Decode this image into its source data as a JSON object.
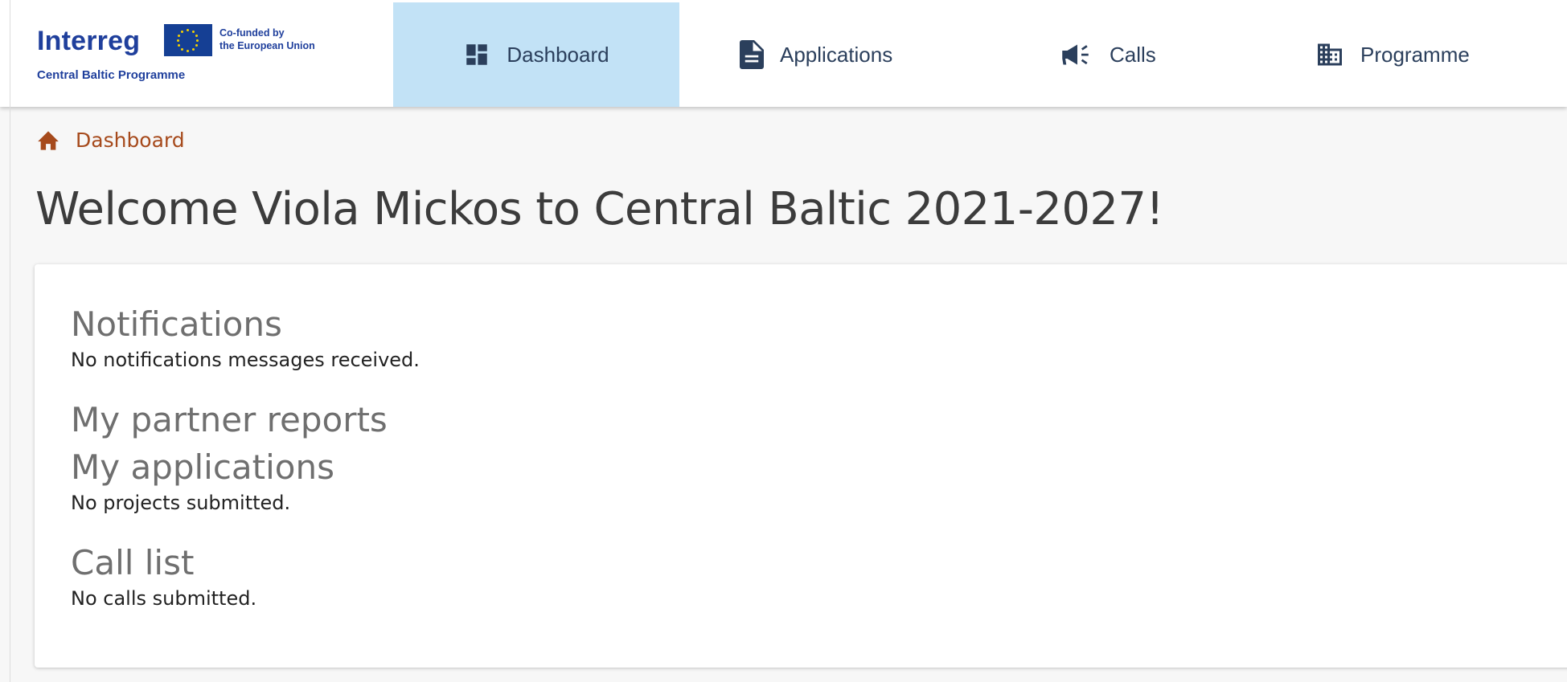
{
  "logo": {
    "wordmark": "Interreg",
    "cofunded_line1": "Co-funded by",
    "cofunded_line2": "the European Union",
    "programme": "Central Baltic Programme"
  },
  "nav": {
    "items": [
      {
        "label": "Dashboard",
        "icon": "dashboard-icon",
        "active": true
      },
      {
        "label": "Applications",
        "icon": "document-icon",
        "active": false
      },
      {
        "label": "Calls",
        "icon": "megaphone-icon",
        "active": false
      },
      {
        "label": "Programme",
        "icon": "building-icon",
        "active": false
      }
    ]
  },
  "breadcrumb": {
    "icon": "home-icon",
    "label": "Dashboard"
  },
  "page": {
    "title": "Welcome Viola Mickos to Central Baltic 2021-2027!"
  },
  "sections": {
    "notifications": {
      "heading": "Notifications",
      "text": "No notifications messages received."
    },
    "partner_reports": {
      "heading": "My partner reports"
    },
    "applications": {
      "heading": "My applications",
      "text": "No projects submitted."
    },
    "call_list": {
      "heading": "Call list",
      "text": "No calls submitted."
    }
  },
  "colors": {
    "active_nav_bg": "#c2e2f6",
    "brand_blue": "#1f3f9c",
    "breadcrumb": "#a64a1c"
  }
}
